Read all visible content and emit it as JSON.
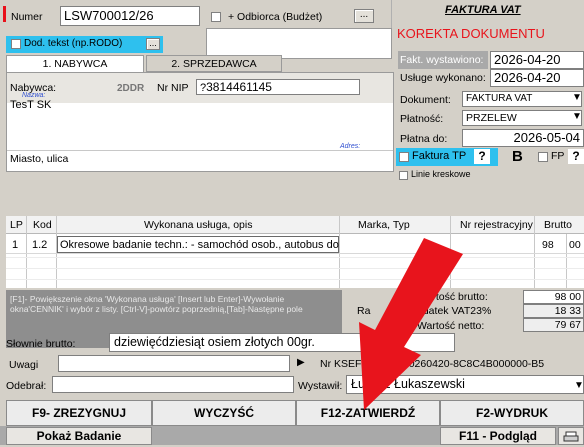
{
  "numer": {
    "label": "Numer",
    "value": "LSW700012/26"
  },
  "odbiorca": {
    "label": "+ Odbiorca (Budżet)",
    "btn": "..."
  },
  "dod_tekst": {
    "label": "Dod. tekst (np.RODO)",
    "btn": "..."
  },
  "tabs": [
    {
      "label": "1. NABYWCA"
    },
    {
      "label": "2. SPRZEDAWCA"
    }
  ],
  "nabywca": {
    "label": "Nabywca:",
    "badge": "2DDR",
    "nip_label": "Nr NIP",
    "nip_q": "?",
    "nip_value": "3814461145",
    "nazwa_hint": "Nazwa:",
    "nazwa_value": "TesT SK",
    "adres_hint": "Adres:",
    "adres_value": "Miasto, ulica"
  },
  "faktura": {
    "title": "FAKTURA VAT",
    "korekta": "KOREKTA DOKUMENTU",
    "wystawienia_label": "Fakt. wystawiono:",
    "wystawienia_value": "2026-04-20",
    "wykonano_label": "Usługe wykonano:",
    "wykonano_value": "2026-04-20",
    "dokument_label": "Dokument:",
    "dokument_value": "FAKTURA VAT",
    "platnosc_label": "Płatność:",
    "platnosc_value": "PRZELEW",
    "platna_do_label": "Płatna do:",
    "platna_do_value": "2026-05-04",
    "faktura_tp": "Faktura TP",
    "q": "?",
    "b": "B",
    "fp": "FP",
    "q2": "?",
    "linie": "Linie kreskowe"
  },
  "table": {
    "headers": [
      "LP",
      "Kod",
      "Wykonana usługa, opis",
      "Marka, Typ",
      "Nr rejestracyjny",
      "Brutto"
    ],
    "rows": [
      {
        "lp": "1",
        "kod": "1.2",
        "opis": "Okresowe badanie techn.: - samochód osob., autobus do",
        "brutto_zl": "98",
        "brutto_gr": "00"
      }
    ]
  },
  "hint": "[F1]- Powiększenie okna 'Wykonana usługa' [Insert lub Enter]-Wywołanie okna'CENNIK' i wybór z listy. [Ctrl-V]-powtórz poprzednią,[Tab]-Następne pole",
  "totals": {
    "rabat": "Ra",
    "brutto_label": "Wartość brutto:",
    "brutto_zl": "98",
    "brutto_gr": "00",
    "vat_label": "Podatek VAT23%",
    "vat_zl": "18",
    "vat_gr": "33",
    "netto_label": "Wartość netto:",
    "netto_zl": "79",
    "netto_gr": "67"
  },
  "slownie": {
    "label": "Słownie brutto:",
    "value": "dziewięćdziesiąt osiem złotych  00gr."
  },
  "uwagi": {
    "label": "Uwagi",
    "arrow": "▶",
    "ksef": "Nr KSEF: 5    3382-20260420-8C8C4B000000-B5"
  },
  "odebral": {
    "label": "Odebrał:",
    "wystawil_label": "Wystawił:",
    "wystawil_value": "Łukasz Łukaszewski"
  },
  "actions": {
    "zrezygnuj": "F9- ZREZYGNUJ",
    "wyczysc": "WYCZYŚĆ",
    "zatwierdz": "F12-ZATWIERDŹ",
    "wydruk": "F2-WYDRUK"
  },
  "footer": {
    "pokaz": "Pokaż Badanie",
    "podglad": "F11 - Podgląd"
  },
  "colors": {
    "accent_red": "#e8141c",
    "arrow_red": "#e8141c",
    "blue_frame": "#2ec0ee"
  }
}
